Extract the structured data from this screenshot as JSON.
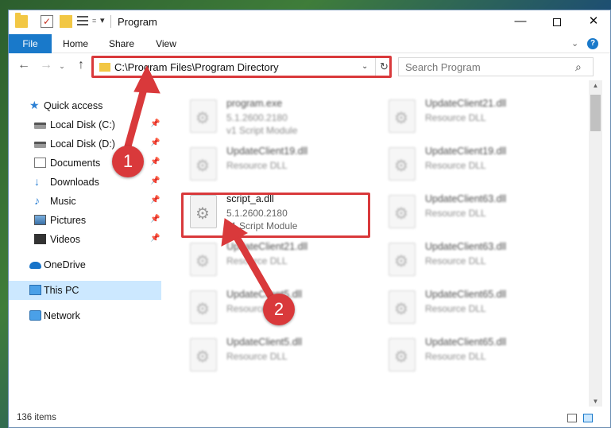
{
  "window": {
    "title": "Program",
    "controls": {
      "minimize": "—",
      "maximize": "",
      "close": "✕"
    }
  },
  "quick_access_toolbar": {
    "arrow": "=",
    "dropdown": "▾"
  },
  "ribbon": {
    "tabs": [
      "File",
      "Home",
      "Share",
      "View"
    ],
    "expand": "⌄",
    "help": "?"
  },
  "nav": {
    "back": "←",
    "forward": "→",
    "recent": "⌄",
    "up": "↑"
  },
  "address_bar": {
    "path": "C:\\Program Files\\Program Directory",
    "dropdown": "⌄",
    "refresh": "↻"
  },
  "search": {
    "placeholder": "Search Program",
    "icon": "⌕"
  },
  "sidebar": {
    "pin": "📌",
    "items": [
      {
        "label": "Quick access",
        "icon": "star-icon",
        "pinned": false
      },
      {
        "label": "Local Disk (C:)",
        "icon": "disk-icon",
        "pinned": true
      },
      {
        "label": "Local Disk (D:)",
        "icon": "disk-icon",
        "pinned": true
      },
      {
        "label": "Documents",
        "icon": "documents-icon",
        "pinned": true
      },
      {
        "label": "Downloads",
        "icon": "downloads-icon",
        "pinned": true
      },
      {
        "label": "Music",
        "icon": "music-icon",
        "pinned": true
      },
      {
        "label": "Pictures",
        "icon": "pictures-icon",
        "pinned": true
      },
      {
        "label": "Videos",
        "icon": "videos-icon",
        "pinned": true
      },
      {
        "label": "OneDrive",
        "icon": "onedrive-icon",
        "pinned": false
      },
      {
        "label": "This PC",
        "icon": "pc-icon",
        "pinned": false,
        "selected": true
      },
      {
        "label": "Network",
        "icon": "network-icon",
        "pinned": false
      }
    ]
  },
  "files": [
    {
      "name": "program.exe",
      "version": "5.1.2600.2180",
      "description": "v1 Script Module"
    },
    {
      "name": "UpdateClient21.dll",
      "version": "Resource DLL",
      "description": ""
    },
    {
      "name": "UpdateClient19.dll",
      "version": "Resource DLL",
      "description": ""
    },
    {
      "name": "UpdateClient19.dll",
      "version": "Resource DLL",
      "description": ""
    },
    {
      "name": "script_a.dll",
      "version": "5.1.2600.2180",
      "description": "v1 Script Module"
    },
    {
      "name": "UpdateClient63.dll",
      "version": "Resource DLL",
      "description": ""
    },
    {
      "name": "UpdateClient21.dll",
      "version": "Resource DLL",
      "description": ""
    },
    {
      "name": "UpdateClient63.dll",
      "version": "Resource DLL",
      "description": ""
    },
    {
      "name": "UpdateClient5.dll",
      "version": "Resource DLL",
      "description": ""
    },
    {
      "name": "UpdateClient65.dll",
      "version": "Resource DLL",
      "description": ""
    },
    {
      "name": "UpdateClient5.dll",
      "version": "Resource DLL",
      "description": ""
    },
    {
      "name": "UpdateClient65.dll",
      "version": "Resource DLL",
      "description": ""
    }
  ],
  "scrollbar": {
    "up": "▲",
    "down": "▼"
  },
  "status_bar": {
    "item_count": "136 items"
  },
  "annotations": {
    "step1": "1",
    "step2": "2",
    "highlight_color": "#d9393b"
  }
}
